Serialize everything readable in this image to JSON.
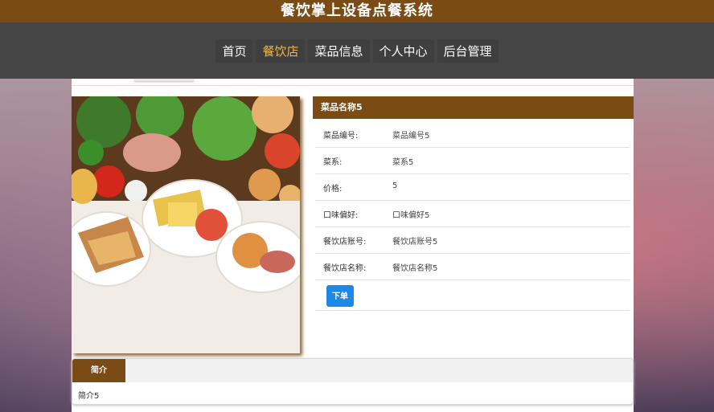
{
  "header": {
    "title": "餐饮掌上设备点餐系统"
  },
  "nav": {
    "items": [
      {
        "label": "首页",
        "active": false
      },
      {
        "label": "餐饮店",
        "active": true
      },
      {
        "label": "菜品信息",
        "active": false
      },
      {
        "label": "个人中心",
        "active": false
      },
      {
        "label": "后台管理",
        "active": false
      }
    ]
  },
  "dish": {
    "name": "菜品名称5",
    "fields": [
      {
        "label": "菜品编号:",
        "value": "菜品编号5"
      },
      {
        "label": "菜系:",
        "value": "菜系5"
      },
      {
        "label": "价格:",
        "value": "5"
      },
      {
        "label": "口味偏好:",
        "value": "口味偏好5"
      },
      {
        "label": "餐饮店账号:",
        "value": "餐饮店账号5"
      },
      {
        "label": "餐饮店名称:",
        "value": "餐饮店名称5"
      }
    ],
    "order_label": "下单"
  },
  "intro": {
    "tab_label": "简介",
    "text": "简介5"
  },
  "colors": {
    "brand": "#7b4b16",
    "nav_bg": "#454545",
    "active_nav": "#f3b93a",
    "button": "#1e88e5"
  }
}
